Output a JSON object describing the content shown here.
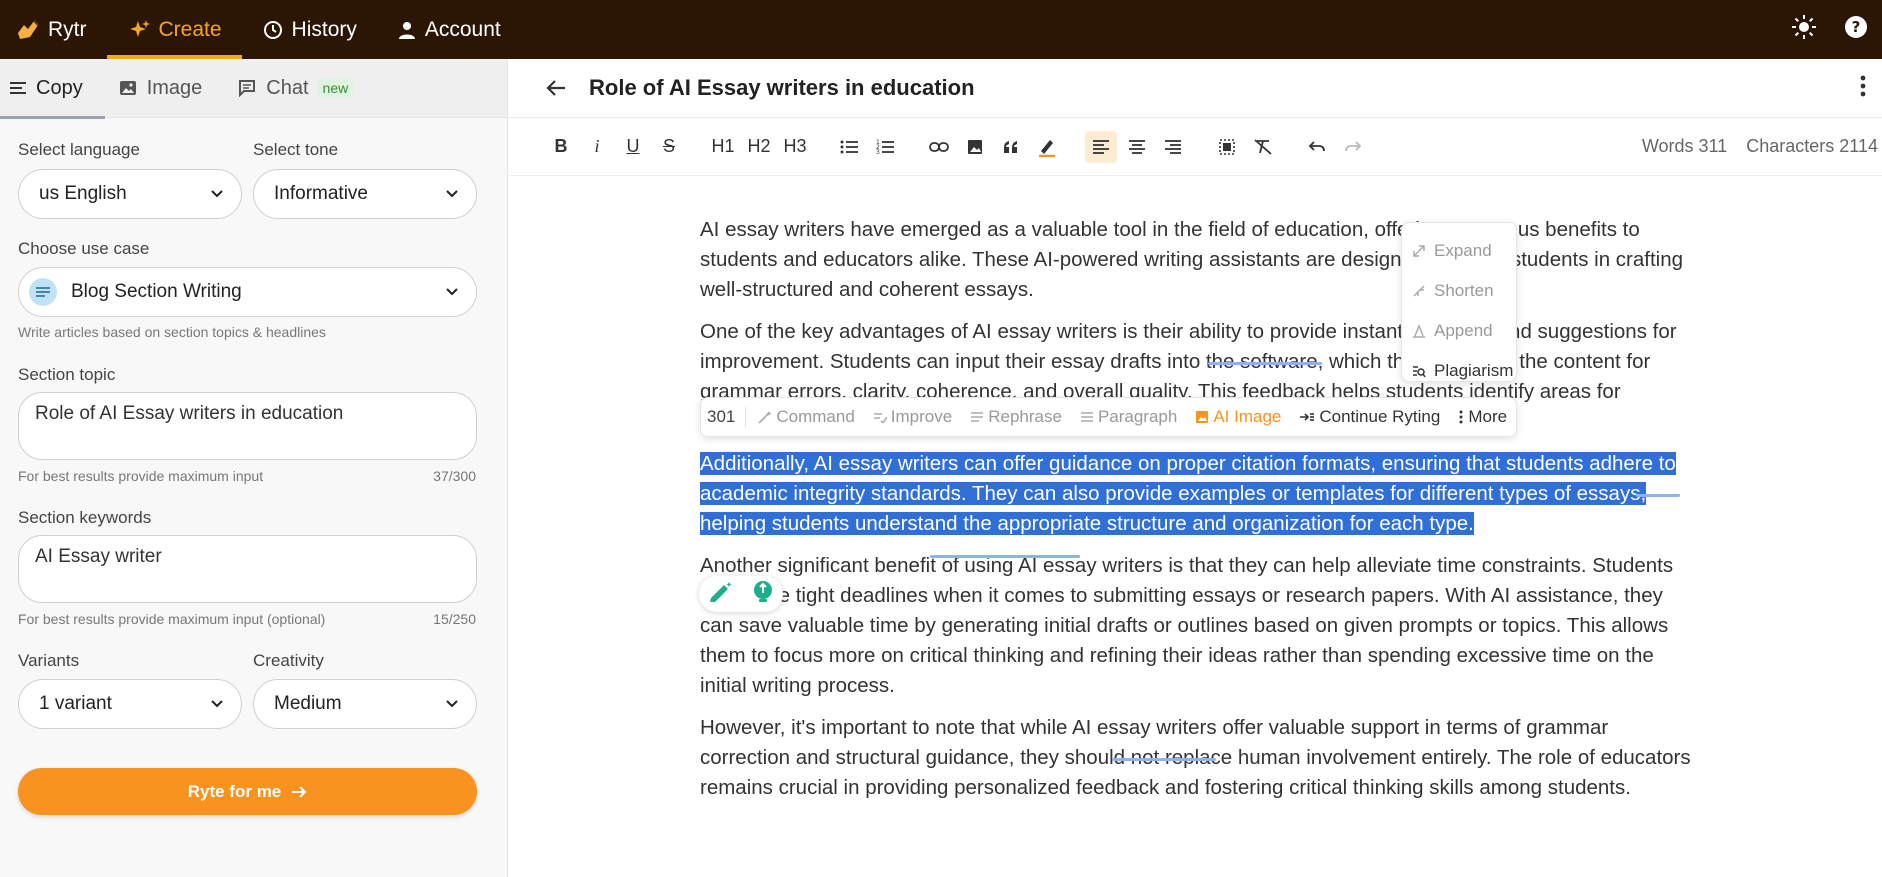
{
  "nav": {
    "brand": "Rytr",
    "items": [
      {
        "label": "Create"
      },
      {
        "label": "History"
      },
      {
        "label": "Account"
      }
    ],
    "icons": {
      "theme": "sun-icon",
      "help": "help-icon"
    }
  },
  "left": {
    "tabs": [
      {
        "label": "Copy"
      },
      {
        "label": "Image"
      },
      {
        "label": "Chat",
        "badge": "new"
      }
    ],
    "language": {
      "label": "Select language",
      "value": "us English"
    },
    "tone": {
      "label": "Select tone",
      "value": "Informative"
    },
    "use_case": {
      "label": "Choose use case",
      "value": "Blog Section Writing",
      "hint": "Write articles based on section topics & headlines"
    },
    "section_topic": {
      "label": "Section topic",
      "value": "Role of AI Essay writers in education",
      "hint": "For best results provide maximum input",
      "count": "37/300"
    },
    "section_keywords": {
      "label": "Section keywords",
      "value": "AI Essay writer",
      "hint": "For best results provide maximum input (optional)",
      "count": "15/250"
    },
    "variants": {
      "label": "Variants",
      "value": "1 variant"
    },
    "creativity": {
      "label": "Creativity",
      "value": "Medium"
    },
    "ryte_button": "Ryte for me"
  },
  "editor": {
    "title": "Role of AI Essay writers in education",
    "toolbar": {
      "bold": "B",
      "italic": "i",
      "underline": "U",
      "strike": "S",
      "h1": "H1",
      "h2": "H2",
      "h3": "H3"
    },
    "counts": {
      "words": "Words 311",
      "characters": "Characters 2114"
    },
    "paragraphs": [
      "AI essay writers have emerged as a valuable tool in the field of education, offering numerous benefits to students and educators alike. These AI-powered writing assistants are designed to assist students in crafting well-structured and coherent essays.",
      "One of the key advantages of AI essay writers is their ability to provide instant feedback and suggestions for improvement. Students can input their essay drafts into the software, which then analyzes the content for grammar errors, clarity, coherence, and overall quality. This feedback helps students identify areas for improvement and make necessary revisions.",
      "Additionally, AI essay writers can offer guidance on proper citation formats, ensuring that students adhere to academic integrity standards. They can also provide examples or templates for different types of essays, helping students understand the appropriate structure and organization for each type.",
      "Another significant benefit of using AI essay writers is that they can help alleviate time constraints. Students often face tight deadlines when it comes to submitting essays or research papers. With AI assistance, they can save valuable time by generating initial drafts or outlines based on given prompts or topics. This allows them to focus more on critical thinking and refining their ideas rather than spending excessive time on the initial writing process.",
      "However, it's important to note that while AI essay writers offer valuable support in terms of grammar correction and structural guidance, they should not replace human involvement entirely. The role of educators remains crucial in providing personalized feedback and fostering critical thinking skills among students."
    ],
    "popup_menu": [
      "Expand",
      "Shorten",
      "Append",
      "Plagiarism"
    ],
    "float_bar": {
      "count": "301",
      "items": [
        "Command",
        "Improve",
        "Rephrase",
        "Paragraph",
        "AI Image",
        "Continue Ryting",
        "More"
      ]
    }
  },
  "colors": {
    "nav_bg": "#2b1606",
    "accent": "#f7931e",
    "selection": "#2f6fd6"
  }
}
